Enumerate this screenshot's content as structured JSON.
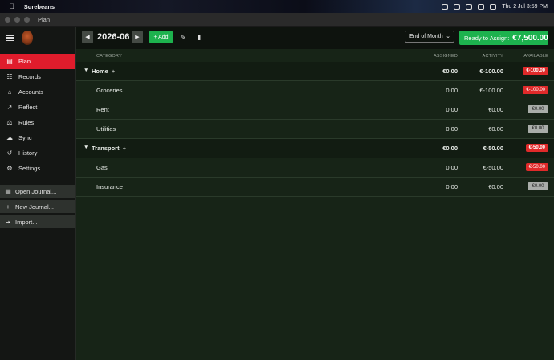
{
  "menubar": {
    "app_name": "Surebeans",
    "datetime": "Thu 2 Jul  3:59 PM"
  },
  "window": {
    "title": "Plan"
  },
  "sidebar": {
    "nav": [
      {
        "label": "Plan",
        "icon": "plan-icon",
        "active": true
      },
      {
        "label": "Records",
        "icon": "records-icon"
      },
      {
        "label": "Accounts",
        "icon": "accounts-icon"
      },
      {
        "label": "Reflect",
        "icon": "reflect-icon"
      },
      {
        "label": "Rules",
        "icon": "rules-icon"
      },
      {
        "label": "Sync",
        "icon": "sync-icon"
      },
      {
        "label": "History",
        "icon": "history-icon"
      },
      {
        "label": "Settings",
        "icon": "settings-icon"
      }
    ],
    "buttons": [
      {
        "label": "Open Journal...",
        "icon": "folder-icon"
      },
      {
        "label": "New Journal...",
        "icon": "plus-icon"
      },
      {
        "label": "Import...",
        "icon": "import-icon"
      }
    ]
  },
  "toolbar": {
    "month": "2026-06",
    "add_label": "+ Add",
    "period": "End of Month",
    "assign_label": "Ready to Assign:",
    "assign_amount": "€7,500.00"
  },
  "columns": {
    "category": "CATEGORY",
    "assigned": "ASSIGNED",
    "activity": "ACTIVITY",
    "available": "AVAILABLE"
  },
  "groups": [
    {
      "name": "Home",
      "assigned": "€0.00",
      "activity": "€-100.00",
      "available": "€-100.00",
      "status": "red",
      "items": [
        {
          "name": "Groceries",
          "assigned": "0.00",
          "activity": "€-100.00",
          "available": "€-100.00",
          "status": "red"
        },
        {
          "name": "Rent",
          "assigned": "0.00",
          "activity": "€0.00",
          "available": "€0.00",
          "status": "grey"
        },
        {
          "name": "Utilities",
          "assigned": "0.00",
          "activity": "€0.00",
          "available": "€0.00",
          "status": "grey"
        }
      ]
    },
    {
      "name": "Transport",
      "assigned": "€0.00",
      "activity": "€-50.00",
      "available": "€-50.00",
      "status": "red",
      "items": [
        {
          "name": "Gas",
          "assigned": "0.00",
          "activity": "€-50.00",
          "available": "€-50.00",
          "status": "red"
        },
        {
          "name": "Insurance",
          "assigned": "0.00",
          "activity": "€0.00",
          "available": "€0.00",
          "status": "grey"
        }
      ]
    }
  ],
  "colors": {
    "accent_green": "#1db24e",
    "danger_red": "#e02a2a",
    "active_nav": "#e01c2c"
  }
}
